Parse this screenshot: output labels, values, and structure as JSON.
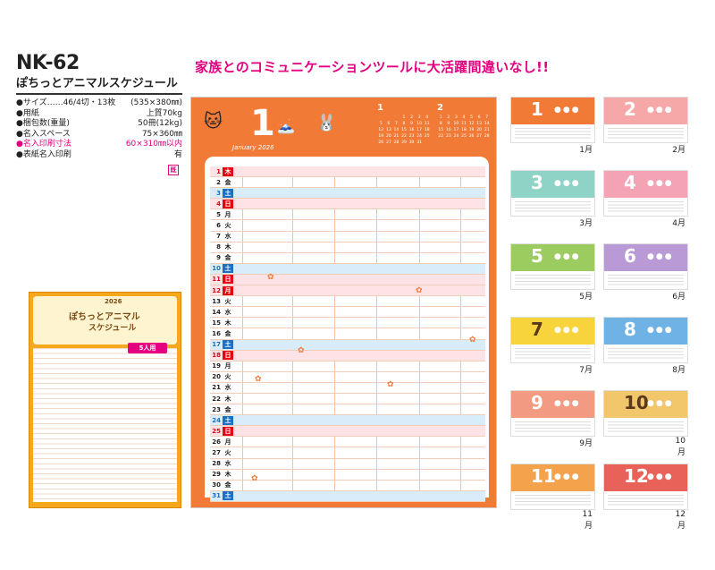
{
  "product": {
    "code": "NK-62",
    "name": "ぽちっとアニマルスケジュール"
  },
  "specs": [
    {
      "label": "●サイズ……46/4切・13枚",
      "value": "(535×380㎜)",
      "pink": false
    },
    {
      "label": "●用紙",
      "value": "上質70kg",
      "pink": false
    },
    {
      "label": "●梱包数(重量)",
      "value": "50冊(12kg)",
      "pink": false
    },
    {
      "label": "●名入スペース",
      "value": "75×360㎜",
      "pink": false
    },
    {
      "label": "●名入印刷寸法",
      "value": "60×310㎜以内",
      "pink": true
    },
    {
      "label": "●表紙名入印刷",
      "value": "有",
      "pink": false
    }
  ],
  "mei_badge": "既",
  "headline": "家族とのコミュニケーションツールに大活躍間違いなし!!",
  "small_calendar": {
    "year": "2026",
    "title": "ぽちっとアニマル",
    "subtitle": "スケジュール",
    "badge": "5人用"
  },
  "main_calendar": {
    "month_number": "1",
    "month_label": "January 2026",
    "mini_months": [
      {
        "num": "1",
        "days": [
          "",
          "",
          "",
          "1",
          "2",
          "3",
          "4",
          "5",
          "6",
          "7",
          "8",
          "9",
          "10",
          "11",
          "12",
          "13",
          "14",
          "15",
          "16",
          "17",
          "18",
          "19",
          "20",
          "21",
          "22",
          "23",
          "24",
          "25",
          "26",
          "27",
          "28",
          "29",
          "30",
          "31"
        ]
      },
      {
        "num": "2",
        "days": [
          "1",
          "2",
          "3",
          "4",
          "5",
          "6",
          "7",
          "8",
          "9",
          "10",
          "11",
          "12",
          "13",
          "14",
          "15",
          "16",
          "17",
          "18",
          "19",
          "20",
          "21",
          "22",
          "23",
          "24",
          "25",
          "26",
          "27",
          "28"
        ]
      }
    ],
    "days": [
      {
        "d": "1",
        "w": "木",
        "type": "holiday"
      },
      {
        "d": "2",
        "w": "金",
        "type": "normal"
      },
      {
        "d": "3",
        "w": "土",
        "type": "sat"
      },
      {
        "d": "4",
        "w": "日",
        "type": "sun"
      },
      {
        "d": "5",
        "w": "月",
        "type": "normal"
      },
      {
        "d": "6",
        "w": "火",
        "type": "normal"
      },
      {
        "d": "7",
        "w": "水",
        "type": "normal"
      },
      {
        "d": "8",
        "w": "木",
        "type": "normal"
      },
      {
        "d": "9",
        "w": "金",
        "type": "normal"
      },
      {
        "d": "10",
        "w": "土",
        "type": "sat"
      },
      {
        "d": "11",
        "w": "日",
        "type": "sun"
      },
      {
        "d": "12",
        "w": "月",
        "type": "holiday"
      },
      {
        "d": "13",
        "w": "火",
        "type": "normal"
      },
      {
        "d": "14",
        "w": "水",
        "type": "normal"
      },
      {
        "d": "15",
        "w": "木",
        "type": "normal"
      },
      {
        "d": "16",
        "w": "金",
        "type": "normal"
      },
      {
        "d": "17",
        "w": "土",
        "type": "sat"
      },
      {
        "d": "18",
        "w": "日",
        "type": "sun"
      },
      {
        "d": "19",
        "w": "月",
        "type": "normal"
      },
      {
        "d": "20",
        "w": "火",
        "type": "normal"
      },
      {
        "d": "21",
        "w": "水",
        "type": "normal"
      },
      {
        "d": "22",
        "w": "木",
        "type": "normal"
      },
      {
        "d": "23",
        "w": "金",
        "type": "normal"
      },
      {
        "d": "24",
        "w": "土",
        "type": "sat"
      },
      {
        "d": "25",
        "w": "日",
        "type": "sun"
      },
      {
        "d": "26",
        "w": "月",
        "type": "normal"
      },
      {
        "d": "27",
        "w": "火",
        "type": "normal"
      },
      {
        "d": "28",
        "w": "水",
        "type": "normal"
      },
      {
        "d": "29",
        "w": "木",
        "type": "normal"
      },
      {
        "d": "30",
        "w": "金",
        "type": "normal"
      },
      {
        "d": "31",
        "w": "土",
        "type": "sat"
      }
    ]
  },
  "thumbnails": [
    {
      "num": "1",
      "label": "1月",
      "color": "#f07a36"
    },
    {
      "num": "2",
      "label": "2月",
      "color": "#f6a7a8"
    },
    {
      "num": "3",
      "label": "3月",
      "color": "#8fd3c7"
    },
    {
      "num": "4",
      "label": "4月",
      "color": "#f4a3b5"
    },
    {
      "num": "5",
      "label": "5月",
      "color": "#9ccc5f"
    },
    {
      "num": "6",
      "label": "6月",
      "color": "#b99ad6"
    },
    {
      "num": "7",
      "label": "7月",
      "color": "#f7d43c"
    },
    {
      "num": "8",
      "label": "8月",
      "color": "#6fb3e6"
    },
    {
      "num": "9",
      "label": "9月",
      "color": "#f39a83"
    },
    {
      "num": "10",
      "label": "10月",
      "color": "#f2c66b"
    },
    {
      "num": "11",
      "label": "11月",
      "color": "#f4a24c"
    },
    {
      "num": "12",
      "label": "12月",
      "color": "#e9625a"
    }
  ]
}
